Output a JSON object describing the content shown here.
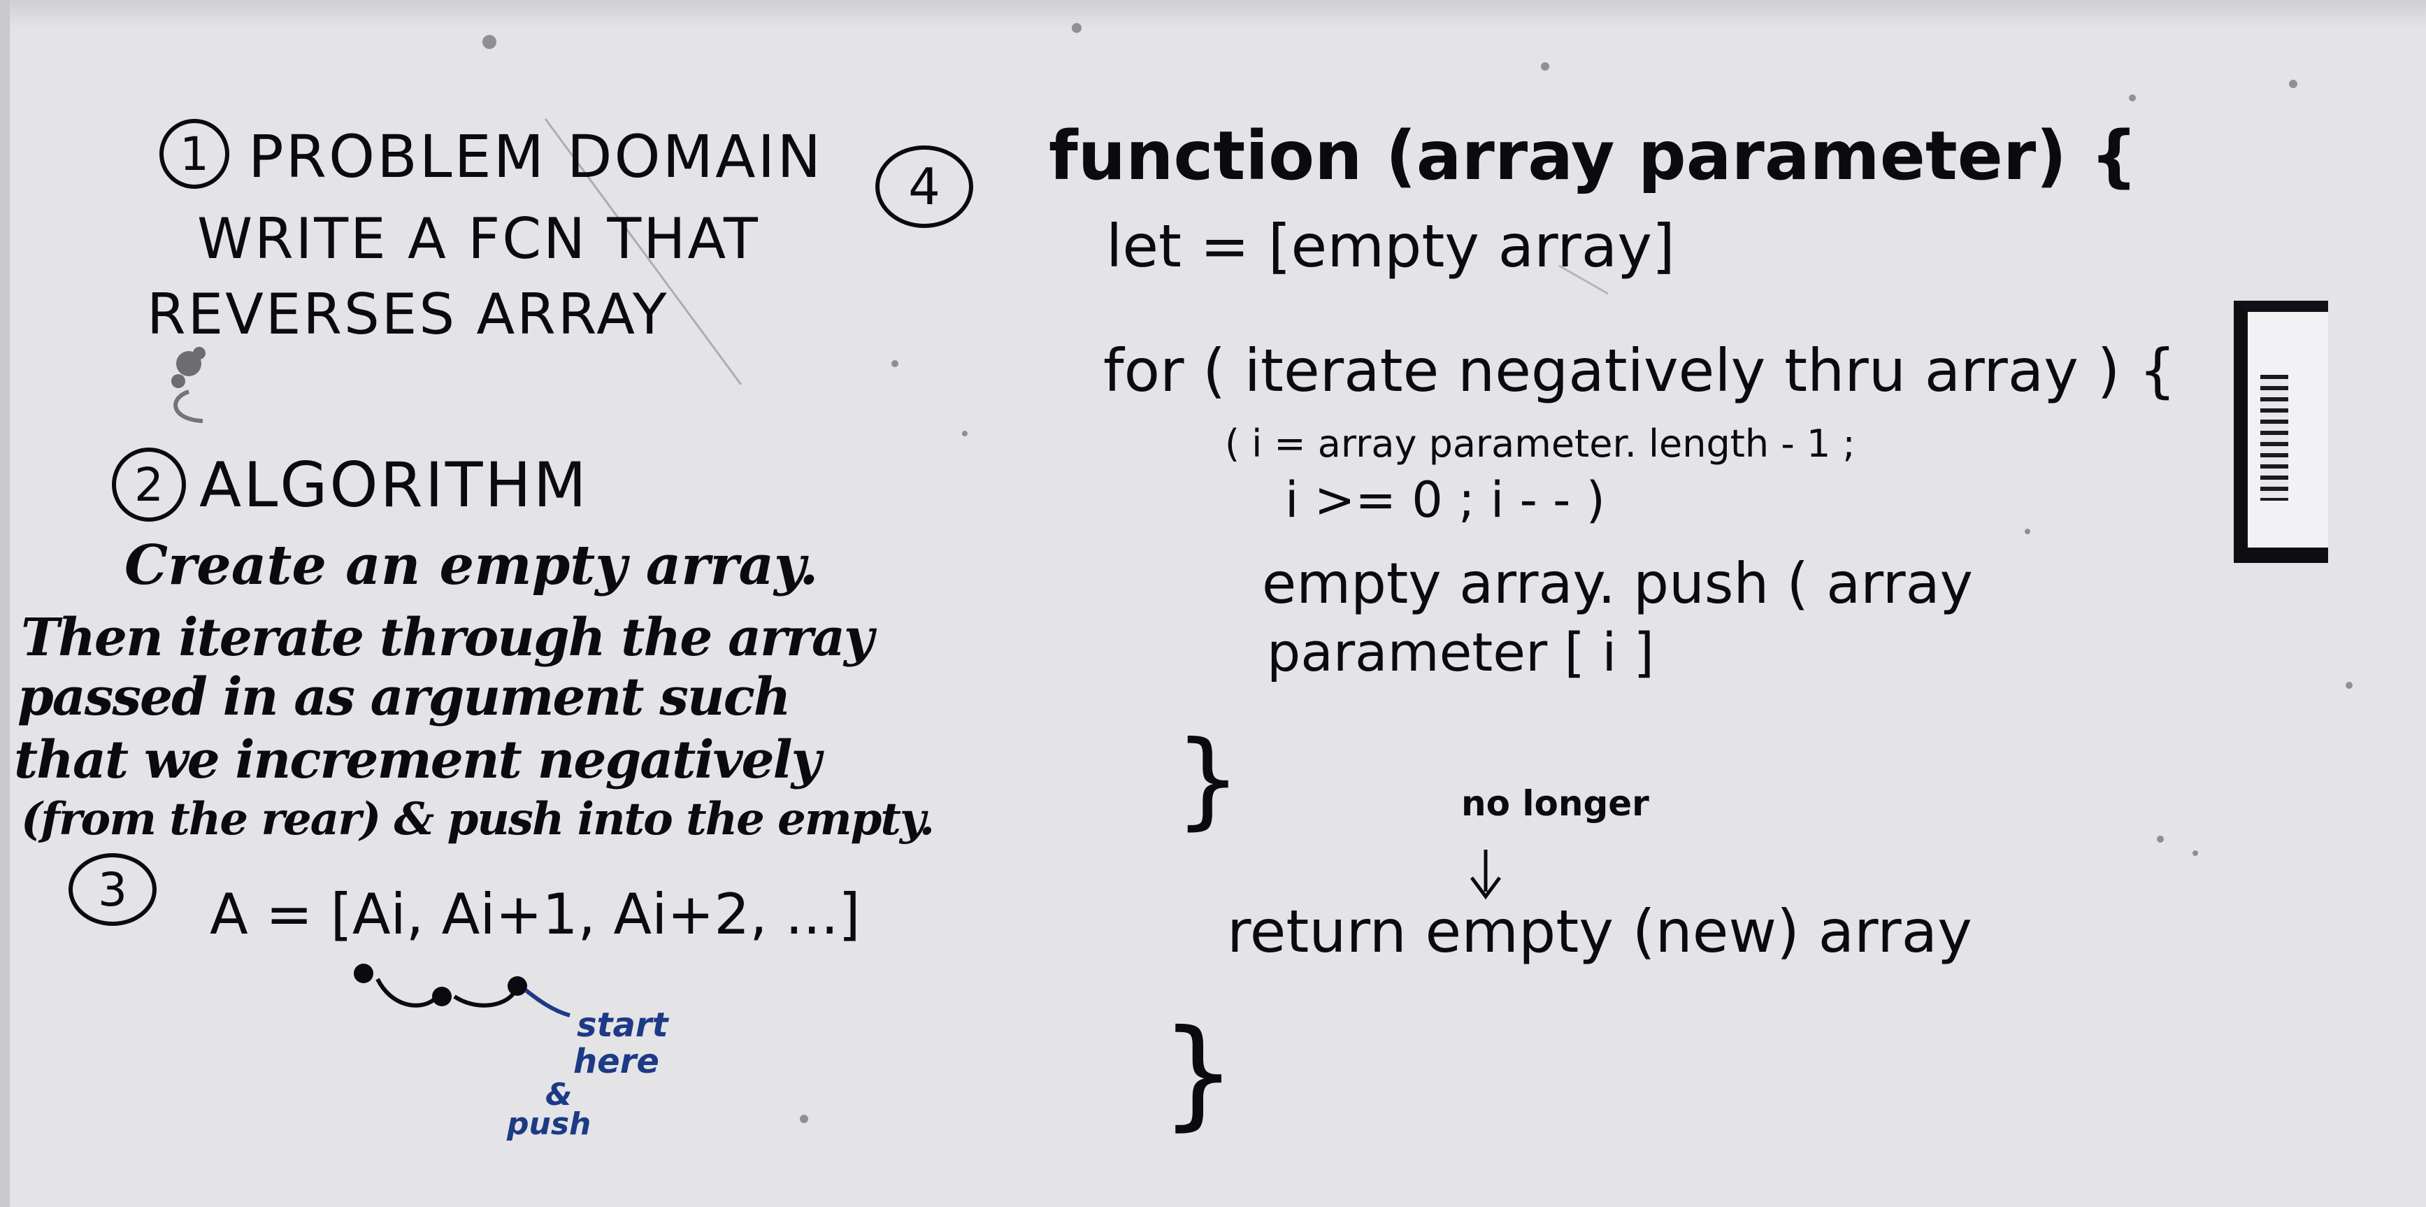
{
  "whiteboard": {
    "section1": {
      "number": "1",
      "title": "PROBLEM DOMAIN",
      "lines": [
        "WRITE A FCN THAT",
        "REVERSES ARRAY"
      ]
    },
    "section2": {
      "number": "2",
      "title": "ALGORITHM",
      "lines": [
        "Create an empty array.",
        "Then iterate through the array",
        "passed in as argument such",
        "that we increment negatively",
        "(from the rear) & push into the empty."
      ]
    },
    "section3": {
      "number": "3",
      "equation": "A = [Ai, Ai+1, Ai+2, ...]",
      "note_lines": [
        "start",
        "here",
        "&",
        "push"
      ]
    },
    "section4": {
      "number": "4",
      "code_lines": [
        "function (array parameter) {",
        "let = [empty array]",
        "for ( iterate negatively thru array ) {",
        "( i = array parameter. length - 1 ;",
        "i >= 0 ; i - - )",
        "empty array. push ( array",
        "parameter [ i ]",
        "}",
        "return empty (new) array",
        "}"
      ],
      "annotation": "no longer"
    }
  }
}
